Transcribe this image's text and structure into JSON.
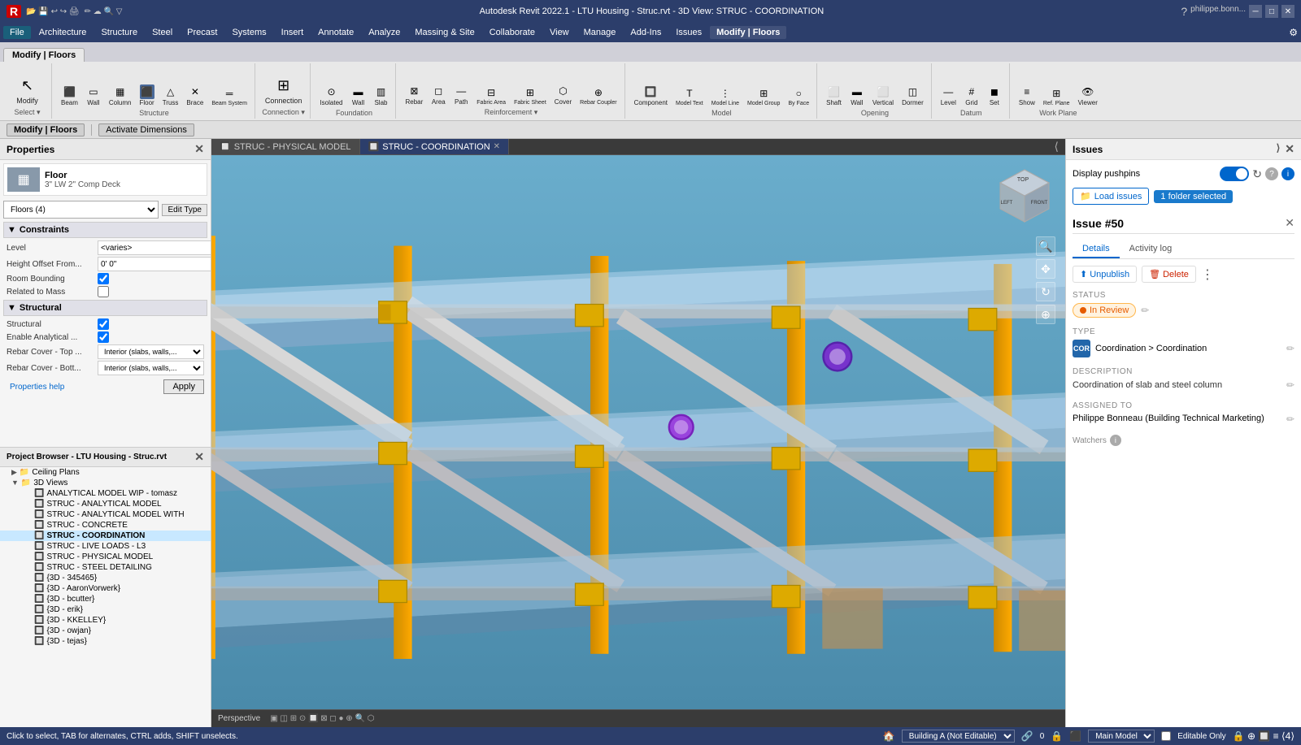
{
  "titleBar": {
    "title": "Autodesk Revit 2022.1 - LTU Housing - Struc.rvt - 3D View: STRUC - COORDINATION",
    "leftIcons": [
      "R-icon",
      "open-icon",
      "save-icon",
      "undo-icon",
      "redo-icon",
      "print-icon"
    ],
    "userName": "philippe.bonn...",
    "winBtns": [
      "minimize",
      "maximize",
      "close"
    ]
  },
  "menuBar": {
    "items": [
      "File",
      "Architecture",
      "Structure",
      "Steel",
      "Precast",
      "Systems",
      "Insert",
      "Annotate",
      "Analyze",
      "Massing & Site",
      "Collaborate",
      "View",
      "Manage",
      "Add-Ins",
      "Issues",
      "Modify | Floors"
    ]
  },
  "ribbon": {
    "activeTab": "Modify | Floors",
    "groups": [
      {
        "label": "Select ▾",
        "items": [
          {
            "icon": "↖",
            "label": "Modify"
          }
        ]
      },
      {
        "label": "Structure",
        "items": [
          {
            "icon": "⬜",
            "label": "Beam"
          },
          {
            "icon": "▭",
            "label": "Wall"
          },
          {
            "icon": "▦",
            "label": "Column"
          },
          {
            "icon": "⬛",
            "label": "Floor"
          },
          {
            "icon": "△",
            "label": "Truss"
          },
          {
            "icon": "✕",
            "label": "Brace"
          },
          {
            "icon": "═",
            "label": "Beam System"
          }
        ]
      },
      {
        "label": "Connection ▾",
        "items": [
          {
            "icon": "⊞",
            "label": "Connection"
          }
        ]
      },
      {
        "label": "Foundation",
        "items": [
          {
            "icon": "▣",
            "label": "Isolated"
          },
          {
            "icon": "▬",
            "label": "Wall"
          },
          {
            "icon": "▥",
            "label": "Slab"
          }
        ]
      },
      {
        "label": "Reinforcement ▾",
        "items": [
          {
            "icon": "⊠",
            "label": "Rebar"
          },
          {
            "icon": "◻",
            "label": "Area"
          },
          {
            "icon": "—",
            "label": "Path"
          },
          {
            "icon": "⊟",
            "label": "Fabric Area"
          },
          {
            "icon": "⊞",
            "label": "Fabric Sheet"
          },
          {
            "icon": "⬡",
            "label": "Cover"
          },
          {
            "icon": "⊕",
            "label": "Rebar Coupler"
          }
        ]
      },
      {
        "label": "Model",
        "items": [
          {
            "icon": "T",
            "label": "Component"
          },
          {
            "icon": "T",
            "label": "Model Text"
          },
          {
            "icon": "⋮",
            "label": "Model Line"
          },
          {
            "icon": "⊞",
            "label": "Model Group"
          },
          {
            "icon": "○",
            "label": "By Face"
          }
        ]
      },
      {
        "label": "Opening",
        "items": [
          {
            "icon": "⬜",
            "label": "Shaft"
          },
          {
            "icon": "▬",
            "label": "Wall"
          },
          {
            "icon": "⬜",
            "label": "Vertical"
          },
          {
            "icon": "◫",
            "label": "Dormer"
          }
        ]
      },
      {
        "label": "Datum",
        "items": [
          {
            "icon": "—",
            "label": "Level"
          },
          {
            "icon": "#",
            "label": "Grid"
          },
          {
            "icon": "◼",
            "label": "Set"
          }
        ]
      },
      {
        "label": "Work Plane",
        "items": [
          {
            "icon": "≡",
            "label": "Show"
          },
          {
            "icon": "⊞",
            "label": "Ref. Plane"
          },
          {
            "icon": "👁",
            "label": "Viewer"
          }
        ]
      }
    ]
  },
  "contextualBar": {
    "tabs": [
      "Modify | Floors",
      "Activate Dimensions"
    ]
  },
  "properties": {
    "title": "Properties",
    "elementIcon": "▦",
    "elementName": "Floor",
    "elementType": "3\" LW 2\" Comp Deck",
    "dropdownValue": "Floors (4)",
    "editTypeLabel": "Edit Type",
    "sections": [
      {
        "name": "Constraints",
        "rows": [
          {
            "label": "Level",
            "value": "<varies>"
          },
          {
            "label": "Height Offset From...",
            "value": "0' 0\""
          },
          {
            "label": "Room Bounding",
            "type": "checkbox",
            "checked": true
          },
          {
            "label": "Related to Mass",
            "type": "checkbox",
            "checked": false
          }
        ]
      },
      {
        "name": "Structural",
        "rows": [
          {
            "label": "Structural",
            "type": "checkbox",
            "checked": true
          },
          {
            "label": "Enable Analytical ...",
            "type": "checkbox",
            "checked": true
          },
          {
            "label": "Rebar Cover - Top ...",
            "value": "Interior (slabs, walls,..."
          },
          {
            "label": "Rebar Cover - Bott...",
            "value": "Interior (slabs, walls,..."
          }
        ]
      }
    ],
    "propertiesHelp": "Properties help",
    "applyBtn": "Apply"
  },
  "projectBrowser": {
    "title": "Project Browser - LTU Housing - Struc.rvt",
    "items": [
      {
        "label": "Ceiling Plans",
        "indent": 1,
        "type": "folder",
        "expanded": false
      },
      {
        "label": "3D Views",
        "indent": 1,
        "type": "folder",
        "expanded": true
      },
      {
        "label": "ANALYTICAL MODEL WIP - tomasz",
        "indent": 3,
        "type": "view"
      },
      {
        "label": "STRUC - ANALYTICAL MODEL",
        "indent": 3,
        "type": "view"
      },
      {
        "label": "STRUC - ANALYTICAL MODEL WITH",
        "indent": 3,
        "type": "view"
      },
      {
        "label": "STRUC - CONCRETE",
        "indent": 3,
        "type": "view"
      },
      {
        "label": "STRUC - COORDINATION",
        "indent": 3,
        "type": "view",
        "bold": true
      },
      {
        "label": "STRUC - LIVE LOADS - L3",
        "indent": 3,
        "type": "view"
      },
      {
        "label": "STRUC - PHYSICAL MODEL",
        "indent": 3,
        "type": "view"
      },
      {
        "label": "STRUC - STEEL DETAILING",
        "indent": 3,
        "type": "view"
      },
      {
        "label": "{3D - 345465}",
        "indent": 3,
        "type": "view"
      },
      {
        "label": "{3D - AaronVorwerk}",
        "indent": 3,
        "type": "view"
      },
      {
        "label": "{3D - bcutter}",
        "indent": 3,
        "type": "view"
      },
      {
        "label": "{3D - erik}",
        "indent": 3,
        "type": "view"
      },
      {
        "label": "{3D - KKELLEY}",
        "indent": 3,
        "type": "view"
      },
      {
        "label": "{3D - owjan}",
        "indent": 3,
        "type": "view"
      },
      {
        "label": "{3D - tejas}",
        "indent": 3,
        "type": "view"
      }
    ]
  },
  "viewport": {
    "tabs": [
      {
        "label": "STRUC - PHYSICAL MODEL",
        "active": false,
        "icon": "🔲"
      },
      {
        "label": "STRUC - COORDINATION",
        "active": true,
        "icon": "🔲"
      }
    ],
    "perspectiveLabel": "Perspective",
    "statusItems": [
      "Building A (Not Editable)",
      "0",
      "Main Model"
    ]
  },
  "issues": {
    "panelTitle": "Issues",
    "displayPushpins": "Display pushpins",
    "toggleOn": true,
    "loadIssues": "Load issues",
    "folderBadge": "1 folder selected",
    "issueNumber": "Issue #50",
    "tabs": [
      "Details",
      "Activity log"
    ],
    "activeTab": "Details",
    "actions": {
      "unpublish": "Unpublish",
      "delete": "Delete"
    },
    "status": {
      "label": "Status",
      "value": "In Review"
    },
    "type": {
      "label": "Type",
      "icon": "COR",
      "value": "Coordination > Coordination"
    },
    "description": {
      "label": "Description",
      "value": "Coordination of slab and steel column"
    },
    "assignedTo": {
      "label": "Assigned to",
      "value": "Philippe Bonneau (Building Technical Marketing)"
    },
    "watchers": {
      "label": "Watchers"
    }
  },
  "statusBar": {
    "leftText": "Click to select, TAB for alternates, CTRL adds, SHIFT unselects.",
    "buildingDropdown": "Building A (Not Editable)",
    "coordValue": "0",
    "modelDropdown": "Main Model",
    "rightLabel": "Editable Only"
  }
}
